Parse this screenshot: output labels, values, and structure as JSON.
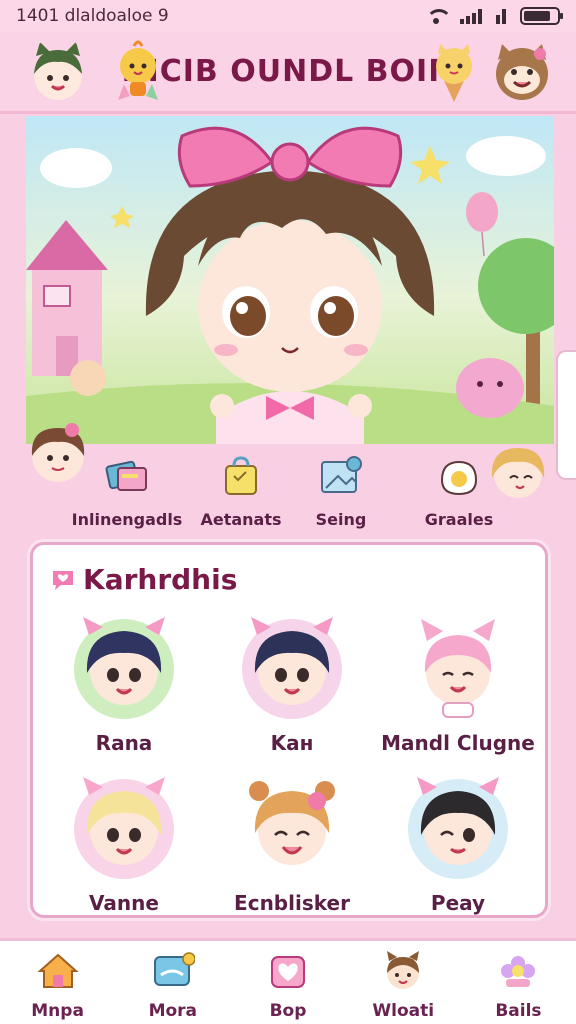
{
  "status_bar": {
    "time_text": "1401 dlaldoaloe 9"
  },
  "header": {
    "title": "DICIB OUNDL BOIN"
  },
  "quick_actions": [
    {
      "label": "Inlinengadls",
      "icon": "cards-icon"
    },
    {
      "label": "Aetanats",
      "icon": "bag-icon"
    },
    {
      "label": "Seing",
      "icon": "photo-icon"
    },
    {
      "label": "Graales",
      "icon": "egg-icon"
    }
  ],
  "characters_card": {
    "title": "Karhrdhis",
    "characters": [
      {
        "name": "Rana",
        "hair": "#2f3560",
        "ear": "#f59ac4",
        "bg": "#cfeec0"
      },
      {
        "name": "Kaн",
        "hair": "#2d3358",
        "ear": "#f59ac4",
        "bg": "#f6d5ea"
      },
      {
        "name": "Mandl Clugne",
        "hair": "#f6a8cc",
        "ear": "#f6a8cc",
        "bg": "#ffffff"
      },
      {
        "name": "Vanne",
        "hair": "#f6e39a",
        "ear": "#f8a6cb",
        "bg": "#f9d3e7"
      },
      {
        "name": "Ecnblisker",
        "hair": "#e3a35a",
        "ear": "#d98e4f",
        "bg": "#ffffff"
      },
      {
        "name": "Peay",
        "hair": "#2d2a2e",
        "ear": "#f59ac4",
        "bg": "#d6ecf6"
      }
    ]
  },
  "bottom_nav": [
    {
      "label": "Mnpa",
      "icon": "home-icon"
    },
    {
      "label": "Mora",
      "icon": "chat-icon"
    },
    {
      "label": "Bop",
      "icon": "shop-heart-icon"
    },
    {
      "label": "Wloati",
      "icon": "cat-face-icon"
    },
    {
      "label": "Bails",
      "icon": "flower-icon"
    }
  ],
  "colors": {
    "accent": "#7a1848",
    "background": "#f9cfe3",
    "card_border": "#e7a7c9"
  }
}
